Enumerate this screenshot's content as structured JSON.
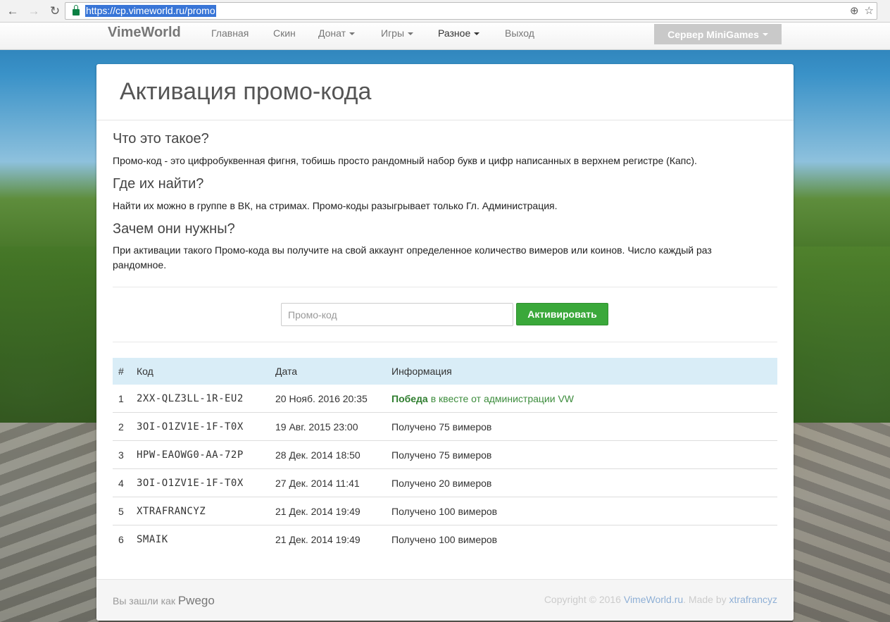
{
  "browser": {
    "url": "https://cp.vimeworld.ru/promo",
    "back_icon": "arrow-left-icon",
    "forward_icon": "arrow-right-icon",
    "reload_icon": "reload-icon",
    "zoom_icon": "zoom-icon",
    "star_icon": "star-icon"
  },
  "navbar": {
    "brand": "VimeWorld",
    "items": [
      {
        "label": "Главная"
      },
      {
        "label": "Скин"
      },
      {
        "label": "Донат"
      },
      {
        "label": "Игры"
      },
      {
        "label": "Разное"
      },
      {
        "label": "Выход"
      }
    ],
    "server_button": "Сервер MiniGames"
  },
  "page": {
    "title": "Активация промо-кода",
    "sections": [
      {
        "heading": "Что это такое?",
        "text": "Промо-код - это цифробуквенная фигня, тобишь просто рандомный набор букв и цифр написанных в верхнем регистре (Капс)."
      },
      {
        "heading": "Где их найти?",
        "text": "Найти их можно в группе в ВК, на стримах. Промо-коды разыгрывает только Гл. Администрация."
      },
      {
        "heading": "Зачем они нужны?",
        "text": "При активации такого Промо-кода вы получите на свой аккаунт определенное количество вимеров или коинов. Число каждый раз рандомное."
      }
    ],
    "input_placeholder": "Промо-код",
    "activate_button": "Активировать"
  },
  "table": {
    "headers": [
      "#",
      "Код",
      "Дата",
      "Информация"
    ],
    "rows": [
      {
        "num": "1",
        "code": "2XX-QLZ3LL-1R-EU2",
        "date": "20 Нояб. 2016 20:35",
        "info_bold": "Победа",
        "info": "в квесте от администрации VW"
      },
      {
        "num": "2",
        "code": "3OI-O1ZV1E-1F-T0X",
        "date": "19 Авг. 2015 23:00",
        "info": "Получено 75 вимеров"
      },
      {
        "num": "3",
        "code": "HPW-EAOWG0-AA-72P",
        "date": "28 Дек. 2014 18:50",
        "info": "Получено 75 вимеров"
      },
      {
        "num": "4",
        "code": "3OI-O1ZV1E-1F-T0X",
        "date": "27 Дек. 2014 11:41",
        "info": "Получено 20 вимеров"
      },
      {
        "num": "5",
        "code": "XTRAFRANCYZ",
        "date": "21 Дек. 2014 19:49",
        "info": "Получено 100 вимеров"
      },
      {
        "num": "6",
        "code": "SMAIK",
        "date": "21 Дек. 2014 19:49",
        "info": "Получено 100 вимеров"
      }
    ]
  },
  "footer": {
    "logged_in_prefix": "Вы зашли как",
    "username": "Pwego",
    "copyright": "Copyright © 2016",
    "site_link": "VimeWorld.ru",
    "made_by": ". Made by",
    "author_link": "xtrafrancyz"
  }
}
